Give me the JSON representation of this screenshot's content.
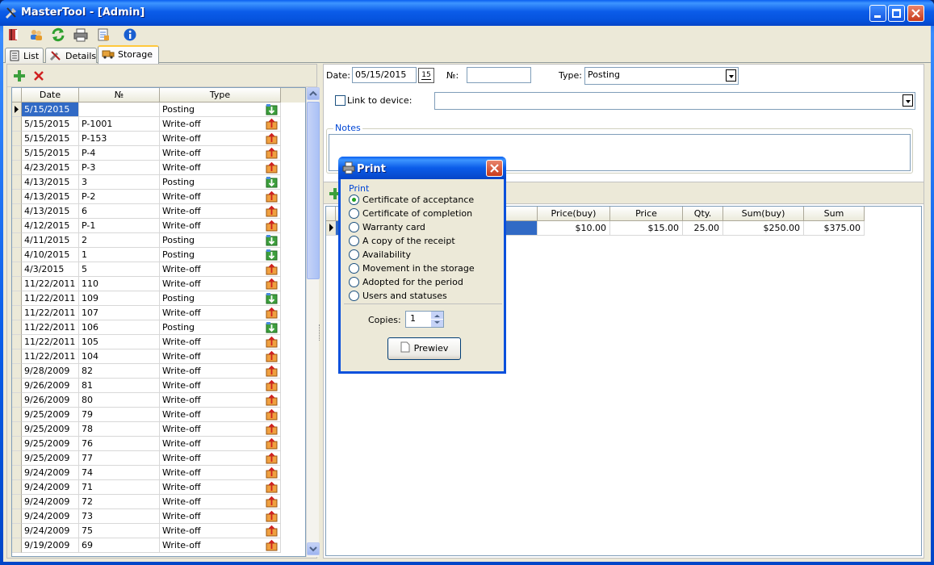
{
  "window": {
    "title": "MasterTool - [Admin]"
  },
  "toolbar": {
    "icons": [
      "book-icon",
      "users-icon",
      "refresh-icon",
      "printer-icon",
      "export-icon",
      "info-icon"
    ]
  },
  "tabs": [
    {
      "label": "List"
    },
    {
      "label": "Details"
    },
    {
      "label": "Storage"
    }
  ],
  "left_grid": {
    "columns": [
      "Date",
      "№",
      "Type"
    ],
    "rows": [
      {
        "date": "5/15/2015",
        "no": "",
        "type": "Posting"
      },
      {
        "date": "5/15/2015",
        "no": "P-1001",
        "type": "Write-off"
      },
      {
        "date": "5/15/2015",
        "no": "P-153",
        "type": "Write-off"
      },
      {
        "date": "5/15/2015",
        "no": "P-4",
        "type": "Write-off"
      },
      {
        "date": "4/23/2015",
        "no": "P-3",
        "type": "Write-off"
      },
      {
        "date": "4/13/2015",
        "no": "3",
        "type": "Posting"
      },
      {
        "date": "4/13/2015",
        "no": "P-2",
        "type": "Write-off"
      },
      {
        "date": "4/13/2015",
        "no": "6",
        "type": "Write-off"
      },
      {
        "date": "4/12/2015",
        "no": "P-1",
        "type": "Write-off"
      },
      {
        "date": "4/11/2015",
        "no": "2",
        "type": "Posting"
      },
      {
        "date": "4/10/2015",
        "no": "1",
        "type": "Posting"
      },
      {
        "date": "4/3/2015",
        "no": "5",
        "type": "Write-off"
      },
      {
        "date": "11/22/2011",
        "no": "110",
        "type": "Write-off"
      },
      {
        "date": "11/22/2011",
        "no": "109",
        "type": "Posting"
      },
      {
        "date": "11/22/2011",
        "no": "107",
        "type": "Write-off"
      },
      {
        "date": "11/22/2011",
        "no": "106",
        "type": "Posting"
      },
      {
        "date": "11/22/2011",
        "no": "105",
        "type": "Write-off"
      },
      {
        "date": "11/22/2011",
        "no": "104",
        "type": "Write-off"
      },
      {
        "date": "9/28/2009",
        "no": "82",
        "type": "Write-off"
      },
      {
        "date": "9/26/2009",
        "no": "81",
        "type": "Write-off"
      },
      {
        "date": "9/26/2009",
        "no": "80",
        "type": "Write-off"
      },
      {
        "date": "9/25/2009",
        "no": "79",
        "type": "Write-off"
      },
      {
        "date": "9/25/2009",
        "no": "78",
        "type": "Write-off"
      },
      {
        "date": "9/25/2009",
        "no": "76",
        "type": "Write-off"
      },
      {
        "date": "9/25/2009",
        "no": "77",
        "type": "Write-off"
      },
      {
        "date": "9/24/2009",
        "no": "74",
        "type": "Write-off"
      },
      {
        "date": "9/24/2009",
        "no": "71",
        "type": "Write-off"
      },
      {
        "date": "9/24/2009",
        "no": "72",
        "type": "Write-off"
      },
      {
        "date": "9/24/2009",
        "no": "73",
        "type": "Write-off"
      },
      {
        "date": "9/24/2009",
        "no": "75",
        "type": "Write-off"
      },
      {
        "date": "9/19/2009",
        "no": "69",
        "type": "Write-off"
      }
    ]
  },
  "form": {
    "date_label": "Date:",
    "date_value": "05/15/2015",
    "calendar_label": "15",
    "no_label": "№:",
    "no_value": "",
    "type_label": "Type:",
    "type_value": "Posting",
    "link_label": "Link to device:",
    "device_value": "",
    "notes_label": "Notes"
  },
  "items_grid": {
    "columns": [
      "Price(buy)",
      "Price",
      "Qty.",
      "Sum(buy)",
      "Sum"
    ],
    "row": [
      "$10.00",
      "$15.00",
      "25.00",
      "$250.00",
      "$375.00"
    ]
  },
  "dialog": {
    "title": "Print",
    "group_label": "Print",
    "options": [
      "Certificate of acceptance",
      "Certificate of completion",
      "Warranty card",
      "A copy of the receipt",
      "Availability",
      "Movement in the storage",
      "Adopted for the period",
      "Users and statuses"
    ],
    "selected_index": 0,
    "copies_label": "Copies:",
    "copies_value": "1",
    "preview_label": "Prewiev"
  }
}
